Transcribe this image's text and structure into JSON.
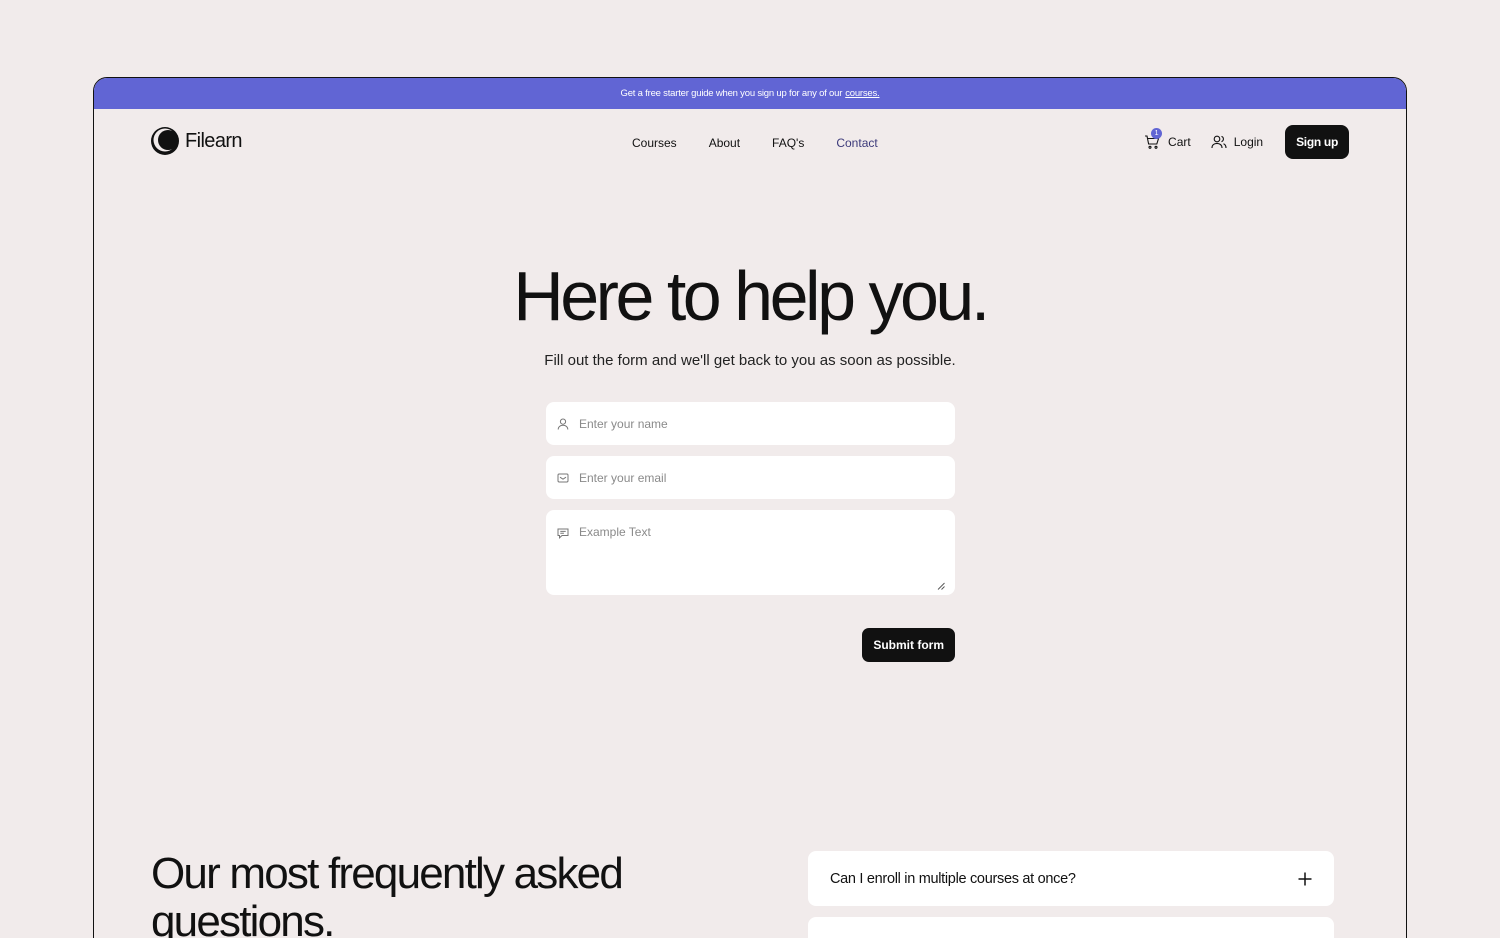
{
  "announcement": {
    "text": "Get a free starter guide when you sign up for any of our",
    "link": "courses."
  },
  "brand": {
    "name": "Filearn"
  },
  "nav": {
    "links": [
      "Courses",
      "About",
      "FAQ's",
      "Contact"
    ],
    "active": "Contact",
    "cart_label": "Cart",
    "cart_count": "1",
    "login_label": "Login",
    "signup_label": "Sign up"
  },
  "hero": {
    "title": "Here to help you.",
    "subtitle": "Fill out the form and we'll get back to you as soon as possible."
  },
  "form": {
    "name_placeholder": "Enter your name",
    "email_placeholder": "Enter your email",
    "message_placeholder": "Example Text",
    "submit_label": "Submit form"
  },
  "faq": {
    "title": "Our most frequently asked questions.",
    "items": [
      "Can I enroll in multiple courses at once?",
      ""
    ]
  },
  "colors": {
    "accent": "#6165d4",
    "background": "#f1ebeb",
    "dark": "#111111"
  }
}
